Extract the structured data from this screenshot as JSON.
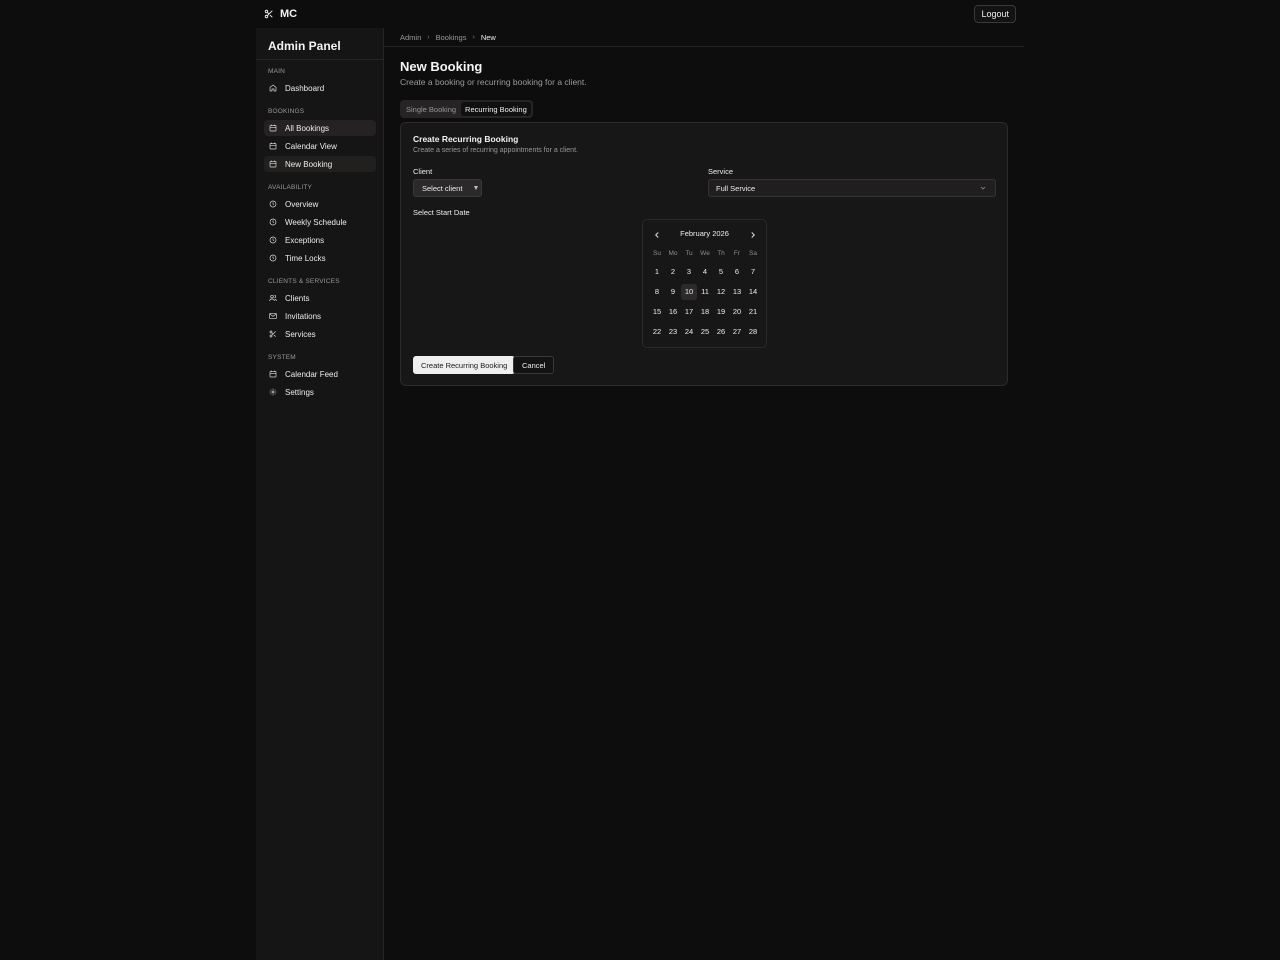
{
  "app": {
    "brand": "MC",
    "logout_label": "Logout"
  },
  "sidebar": {
    "title": "Admin Panel",
    "sections": [
      {
        "label": "Main",
        "items": [
          {
            "label": "Dashboard",
            "icon": "home-icon"
          }
        ]
      },
      {
        "label": "Bookings",
        "items": [
          {
            "label": "All Bookings",
            "icon": "calendar-icon"
          },
          {
            "label": "Calendar View",
            "icon": "calendar-icon"
          },
          {
            "label": "New Booking",
            "icon": "calendar-icon"
          }
        ]
      },
      {
        "label": "Availability",
        "items": [
          {
            "label": "Overview",
            "icon": "clock-icon"
          },
          {
            "label": "Weekly Schedule",
            "icon": "clock-icon"
          },
          {
            "label": "Exceptions",
            "icon": "clock-icon"
          },
          {
            "label": "Time Locks",
            "icon": "clock-icon"
          }
        ]
      },
      {
        "label": "Clients & Services",
        "items": [
          {
            "label": "Clients",
            "icon": "users-icon"
          },
          {
            "label": "Invitations",
            "icon": "mail-icon"
          },
          {
            "label": "Services",
            "icon": "scissors-icon"
          }
        ]
      },
      {
        "label": "System",
        "items": [
          {
            "label": "Calendar Feed",
            "icon": "calendar-icon"
          },
          {
            "label": "Settings",
            "icon": "gear-icon"
          }
        ]
      }
    ]
  },
  "breadcrumb": {
    "items": [
      "Admin",
      "Bookings",
      "New"
    ]
  },
  "page": {
    "title": "New Booking",
    "subtitle": "Create a booking or recurring booking for a client."
  },
  "tabs": [
    {
      "label": "Single Booking",
      "active": false
    },
    {
      "label": "Recurring Booking",
      "active": true
    }
  ],
  "form": {
    "title": "Create Recurring Booking",
    "subtitle": "Create a series of recurring appointments for a client.",
    "client_label": "Client",
    "client_value": "Select client",
    "service_label": "Service",
    "service_value": "Full Service",
    "start_date_label": "Select Start Date",
    "submit_label": "Create Recurring Booking",
    "cancel_label": "Cancel"
  },
  "calendar": {
    "month": "February 2026",
    "weekdays": [
      "Su",
      "Mo",
      "Tu",
      "We",
      "Th",
      "Fr",
      "Sa"
    ],
    "days": [
      "1",
      "2",
      "3",
      "4",
      "5",
      "6",
      "7",
      "8",
      "9",
      "10",
      "11",
      "12",
      "13",
      "14",
      "15",
      "16",
      "17",
      "18",
      "19",
      "20",
      "21",
      "22",
      "23",
      "24",
      "25",
      "26",
      "27",
      "28"
    ],
    "today": "10"
  },
  "colors": {
    "background": "#0e0d0d",
    "sidebar": "#161515",
    "card": "#181717",
    "primary_button": "#efefef"
  }
}
